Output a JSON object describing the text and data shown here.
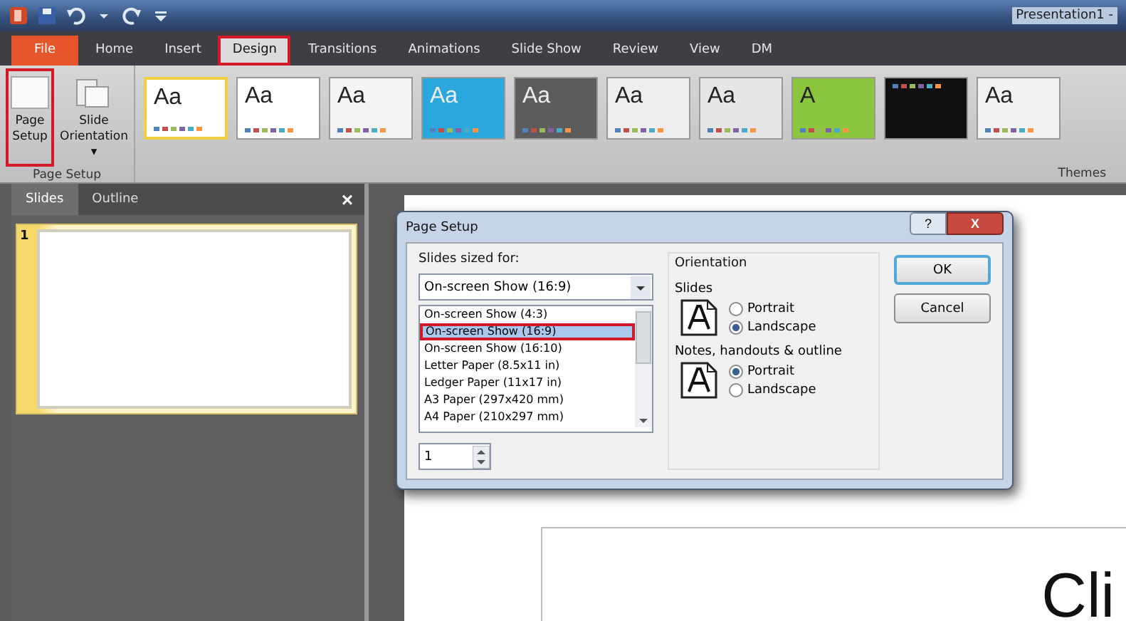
{
  "window": {
    "title": "Presentation1 -"
  },
  "quick_access": [
    {
      "kind": "app"
    },
    {
      "kind": "save"
    },
    {
      "kind": "undo"
    },
    {
      "kind": "dropdown"
    },
    {
      "kind": "redo"
    },
    {
      "kind": "customize"
    }
  ],
  "tabs": [
    {
      "label": "File",
      "kind": "file",
      "selected": false,
      "highlighted": false
    },
    {
      "label": "Home",
      "kind": "tab",
      "selected": false,
      "highlighted": false
    },
    {
      "label": "Insert",
      "kind": "tab",
      "selected": false,
      "highlighted": false
    },
    {
      "label": "Design",
      "kind": "tab",
      "selected": true,
      "highlighted": true
    },
    {
      "label": "Transitions",
      "kind": "tab",
      "selected": false,
      "highlighted": false
    },
    {
      "label": "Animations",
      "kind": "tab",
      "selected": false,
      "highlighted": false
    },
    {
      "label": "Slide Show",
      "kind": "tab",
      "selected": false,
      "highlighted": false
    },
    {
      "label": "Review",
      "kind": "tab",
      "selected": false,
      "highlighted": false
    },
    {
      "label": "View",
      "kind": "tab",
      "selected": false,
      "highlighted": false
    },
    {
      "label": "DM",
      "kind": "tab",
      "selected": false,
      "highlighted": false
    }
  ],
  "ribbon": {
    "page_setup_group": {
      "label": "Page Setup",
      "buttons": [
        {
          "label": "Page Setup",
          "kind": "page",
          "highlighted": true
        },
        {
          "label": "Slide Orientation ▾",
          "kind": "orientation",
          "highlighted": false
        }
      ]
    },
    "themes_group": {
      "label": "Themes",
      "themes": [
        {
          "label": "Aa",
          "color": "#ffffff",
          "selected": true
        },
        {
          "label": "Aa",
          "color": "#ffffff",
          "selected": false
        },
        {
          "label": "Aa",
          "color": "#f4f4f4",
          "selected": false
        },
        {
          "label": "Aa",
          "color": "#2aa7dc",
          "selected": false
        },
        {
          "label": "Aa",
          "color": "#5c5c5c",
          "selected": false
        },
        {
          "label": "Aa",
          "color": "#eeeeee",
          "selected": false
        },
        {
          "label": "Aa",
          "color": "#e6e6e6",
          "selected": false
        },
        {
          "label": "A",
          "color": "#8cc63e",
          "selected": false
        },
        {
          "color": "#101010",
          "selected": false
        },
        {
          "label": "Aa",
          "color": "#f2f2f2",
          "selected": false
        }
      ]
    }
  },
  "side_panel": {
    "tabs": [
      {
        "label": "Slides",
        "selected": true
      },
      {
        "label": "Outline",
        "selected": false
      }
    ],
    "close": "×",
    "slides": [
      {
        "number": "1",
        "selected": true
      }
    ]
  },
  "slide": {
    "title": "Cli"
  },
  "dialog": {
    "title": "Page Setup",
    "help": "?",
    "close": "X",
    "size_label": "Slides sized for:",
    "size_value": "On-screen Show (16:9)",
    "size_options": [
      {
        "label": "On-screen Show (4:3)",
        "selected": false,
        "highlighted": false
      },
      {
        "label": "On-screen Show (16:9)",
        "selected": true,
        "highlighted": true
      },
      {
        "label": "On-screen Show (16:10)",
        "selected": false,
        "highlighted": false
      },
      {
        "label": "Letter Paper (8.5x11 in)",
        "selected": false,
        "highlighted": false
      },
      {
        "label": "Ledger Paper (11x17 in)",
        "selected": false,
        "highlighted": false
      },
      {
        "label": "A3 Paper (297x420 mm)",
        "selected": false,
        "highlighted": false
      },
      {
        "label": "A4 Paper (210x297 mm)",
        "selected": false,
        "highlighted": false
      }
    ],
    "number_value": "1",
    "orientation": {
      "label": "Orientation",
      "groups": [
        {
          "label": "Slides",
          "options": [
            {
              "label": "Portrait",
              "selected": false
            },
            {
              "label": "Landscape",
              "selected": true
            }
          ]
        },
        {
          "label": "Notes, handouts & outline",
          "options": [
            {
              "label": "Portrait",
              "selected": true
            },
            {
              "label": "Landscape",
              "selected": false
            }
          ]
        }
      ]
    },
    "buttons": [
      {
        "label": "OK",
        "default": true
      },
      {
        "label": "Cancel",
        "default": false
      }
    ]
  }
}
